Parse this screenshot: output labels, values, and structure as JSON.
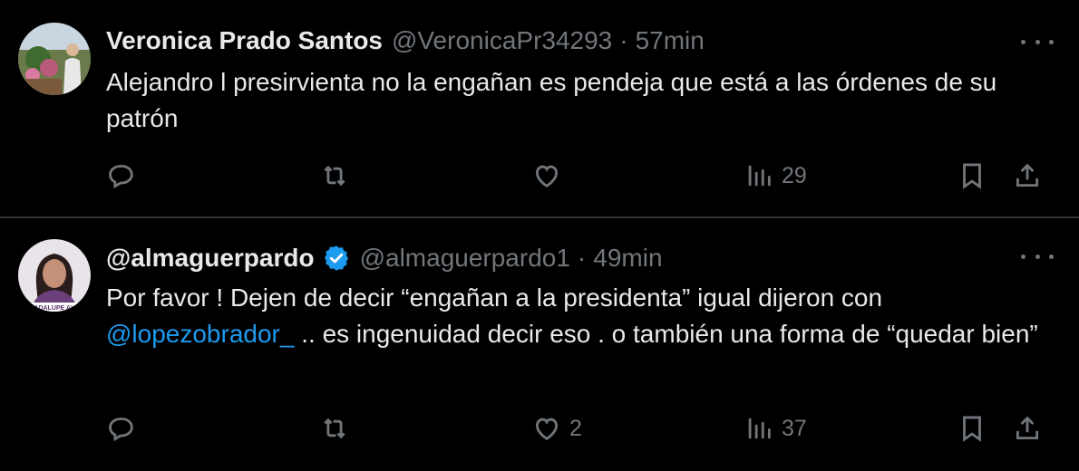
{
  "tweets": [
    {
      "name": "Veronica Prado Santos",
      "handle": "@VeronicaPr34293",
      "separator": "·",
      "time": "57min",
      "text": "Alejandro l presirvienta no la engañan es pendeja que está a las órdenes de su patrón",
      "verified": false,
      "metrics": {
        "replies": "",
        "reposts": "",
        "likes": "",
        "views": "29"
      },
      "avatar": "photo-person-garden"
    },
    {
      "name": "@almaguerpardo",
      "handle": "@almaguerpardo1",
      "separator": "·",
      "time": "49min",
      "text_before": "Por favor ! Dejen de decir “engañan a la presidenta” igual dijeron con ",
      "mention": "@lopezobrador_",
      "text_after": " .. es ingenuidad decir eso . o también una forma de “quedar bien”",
      "verified": true,
      "verified_color": "#1d9bf0",
      "avatar_caption": "GUADALUPE ALMA",
      "metrics": {
        "replies": "",
        "reposts": "",
        "likes": "2",
        "views": "37"
      },
      "avatar": "photo-woman-portrait"
    }
  ],
  "colors": {
    "background": "#000000",
    "text": "#e7e9ea",
    "muted": "#71767b",
    "link": "#1d9bf0",
    "divider": "#2f3336"
  }
}
